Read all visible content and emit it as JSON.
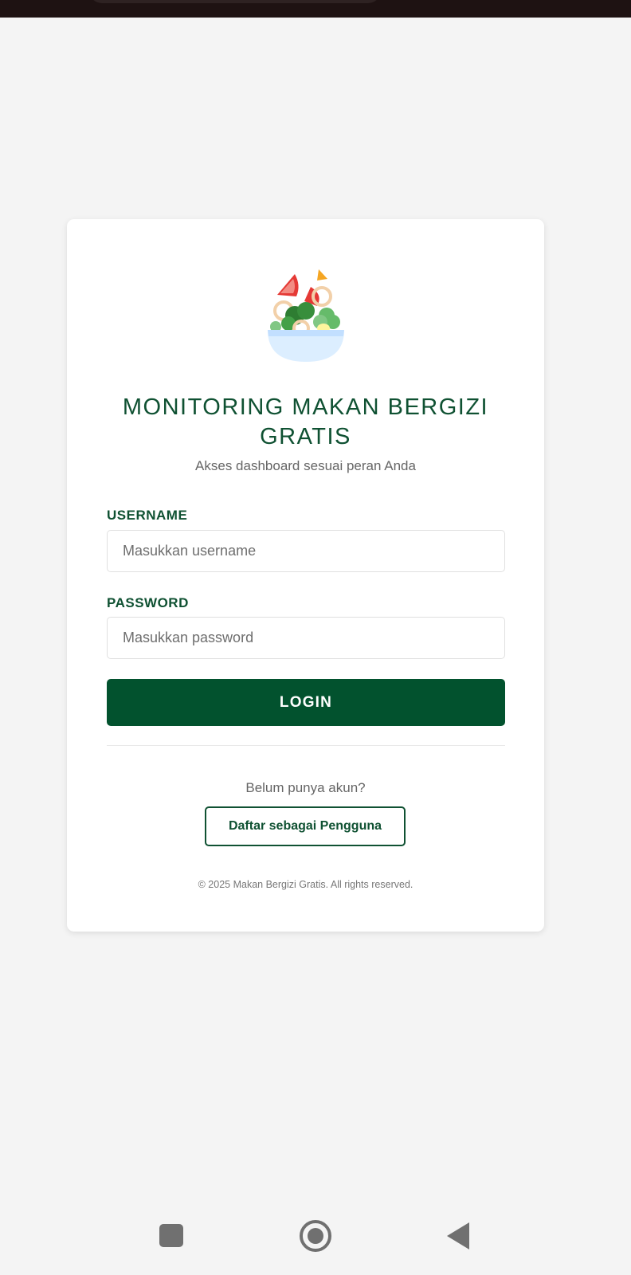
{
  "app": {
    "title_line1": "MONITORING MAKAN BERGIZI",
    "title_line2": "GRATIS",
    "subtitle": "Akses dashboard sesuai peran Anda",
    "logo_icon": "salad-bowl-icon"
  },
  "form": {
    "username_label": "USERNAME",
    "username_placeholder": "Masukkan username",
    "username_value": "",
    "password_label": "PASSWORD",
    "password_placeholder": "Masukkan password",
    "password_value": "",
    "login_label": "LOGIN"
  },
  "register": {
    "prompt": "Belum punya akun?",
    "button_label": "Daftar sebagai Pengguna"
  },
  "footer": {
    "copyright": "© 2025 Makan Bergizi Gratis. All rights reserved."
  },
  "navigation": {
    "recent_icon": "recent-apps-icon",
    "home_icon": "home-icon",
    "back_icon": "back-icon"
  },
  "colors": {
    "primary": "#02522e",
    "title": "#0f5132",
    "background": "#f4f4f4",
    "card": "#ffffff"
  }
}
